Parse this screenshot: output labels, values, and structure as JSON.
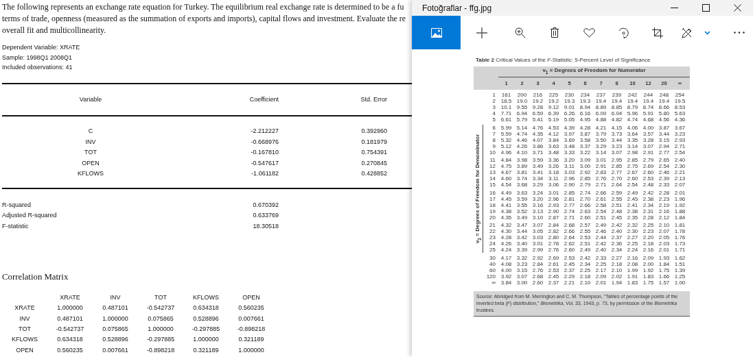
{
  "document": {
    "paragraph_lines": [
      "The following represents an exchange rate equation for Turkey. The equilibrium real exchange rate is determined to be a fu",
      "terms of trade, openness (measured as the summation of exports and imports), capital flows and investment. Evaluate the re",
      "overall fit and multicollinearity."
    ],
    "info": [
      "Dependent Variable: XRATE",
      "Sample: 1998Q1 2008Q1",
      "Included observations: 41"
    ],
    "regression": {
      "columns": [
        "Variable",
        "Coefficient",
        "Std. Error"
      ],
      "rows": [
        {
          "variable": "C",
          "coefficient": "-2.212227",
          "std_error": "0.392960"
        },
        {
          "variable": "INV",
          "coefficient": "-0.668976",
          "std_error": "0.181979"
        },
        {
          "variable": "TOT",
          "coefficient": "-0.167810",
          "std_error": "0.754391"
        },
        {
          "variable": "OPEN",
          "coefficient": "-0.547617",
          "std_error": "0.270845"
        },
        {
          "variable": "KFLOWS",
          "coefficient": "-1.061182",
          "std_error": "0.428852"
        }
      ],
      "stats": [
        {
          "label": "R-squared",
          "value": "0.670392"
        },
        {
          "label": "Adjusted R-squared",
          "value": "0.633769"
        },
        {
          "label": "F-statistic",
          "value": "18.30518"
        }
      ]
    },
    "correlation": {
      "title": "Correlation Matrix",
      "columns": [
        "XRATE",
        "INV",
        "TOT",
        "KFLOWS",
        "OPEN"
      ],
      "rows": [
        {
          "label": "XRATE",
          "values": [
            "1.000000",
            "0.487101",
            "-0.542737",
            "0.634318",
            "0.560235"
          ]
        },
        {
          "label": "INV",
          "values": [
            "0.487101",
            "1.000000",
            "0.075865",
            "0.528896",
            "0.007661"
          ]
        },
        {
          "label": "TOT",
          "values": [
            "-0.542737",
            "0.075865",
            "1.000000",
            "-0.297885",
            "-0.898218"
          ]
        },
        {
          "label": "KFLOWS",
          "values": [
            "0.634318",
            "0.528896",
            "-0.297885",
            "1.000000",
            "0.321189"
          ]
        },
        {
          "label": "OPEN",
          "values": [
            "0.560235",
            "0.007661",
            "-0.898218",
            "0.321189",
            "1.000000"
          ]
        }
      ]
    }
  },
  "photos_window": {
    "title": "Fotoğraflar - ffg.jpg",
    "image": {
      "title": "**Table 2** Critical Values of the *F*-Statistic: 5-Percent Level of Significance",
      "column_axis": "ν$_{1}$ = Degrees of Freedom for Numerator",
      "row_axis": "ν$_{2}$ = Degrees of Freedom for Denominator",
      "columns": [
        "1",
        "2",
        "3",
        "4",
        "5",
        "6",
        "7",
        "8",
        "10",
        "12",
        "20",
        "∞"
      ],
      "groups": [
        {
          "rows": [
            {
              "df": "1",
              "values": [
                "161",
                "200",
                "216",
                "225",
                "230",
                "234",
                "237",
                "239",
                "242",
                "244",
                "248",
                "254"
              ]
            },
            {
              "df": "2",
              "values": [
                "18.5",
                "19.0",
                "19.2",
                "19.2",
                "19.3",
                "19.3",
                "19.4",
                "19.4",
                "19.4",
                "19.4",
                "19.4",
                "19.5"
              ]
            },
            {
              "df": "3",
              "values": [
                "10.1",
                "9.55",
                "9.28",
                "9.12",
                "9.01",
                "8.94",
                "8.89",
                "8.85",
                "8.79",
                "8.74",
                "8.66",
                "8.53"
              ]
            },
            {
              "df": "4",
              "values": [
                "7.71",
                "6.94",
                "6.59",
                "6.39",
                "6.26",
                "6.16",
                "6.09",
                "6.04",
                "5.96",
                "5.91",
                "5.80",
                "5.63"
              ]
            },
            {
              "df": "5",
              "values": [
                "6.61",
                "5.79",
                "5.41",
                "5.19",
                "5.05",
                "4.95",
                "4.88",
                "4.82",
                "4.74",
                "4.68",
                "4.56",
                "4.36"
              ]
            }
          ]
        },
        {
          "rows": [
            {
              "df": "6",
              "values": [
                "5.99",
                "5.14",
                "4.76",
                "4.53",
                "4.39",
                "4.28",
                "4.21",
                "4.15",
                "4.06",
                "4.00",
                "3.87",
                "3.67"
              ]
            },
            {
              "df": "7",
              "values": [
                "5.59",
                "4.74",
                "4.35",
                "4.12",
                "3.97",
                "3.87",
                "3.79",
                "3.73",
                "3.64",
                "3.57",
                "3.44",
                "3.23"
              ]
            },
            {
              "df": "8",
              "values": [
                "5.32",
                "4.46",
                "4.07",
                "3.84",
                "3.69",
                "3.58",
                "3.50",
                "3.44",
                "3.35",
                "3.28",
                "3.15",
                "2.93"
              ]
            },
            {
              "df": "9",
              "values": [
                "5.12",
                "4.26",
                "3.86",
                "3.63",
                "3.48",
                "3.37",
                "3.29",
                "3.23",
                "3.14",
                "3.07",
                "2.94",
                "2.71"
              ]
            },
            {
              "df": "10",
              "values": [
                "4.96",
                "4.10",
                "3.71",
                "3.48",
                "3.33",
                "3.22",
                "3.14",
                "3.07",
                "2.98",
                "2.91",
                "2.77",
                "2.54"
              ]
            }
          ]
        },
        {
          "rows": [
            {
              "df": "11",
              "values": [
                "4.84",
                "3.98",
                "3.59",
                "3.36",
                "3.20",
                "3.09",
                "3.01",
                "2.95",
                "2.85",
                "2.79",
                "2.65",
                "2.40"
              ]
            },
            {
              "df": "12",
              "values": [
                "4.75",
                "3.89",
                "3.49",
                "3.26",
                "3.11",
                "3.00",
                "2.91",
                "2.85",
                "2.75",
                "2.69",
                "2.54",
                "2.30"
              ]
            },
            {
              "df": "13",
              "values": [
                "4.67",
                "3.81",
                "3.41",
                "3.18",
                "3.03",
                "2.92",
                "2.83",
                "2.77",
                "2.67",
                "2.60",
                "2.46",
                "2.21"
              ]
            },
            {
              "df": "14",
              "values": [
                "4.60",
                "3.74",
                "3.34",
                "3.11",
                "2.96",
                "2.85",
                "2.76",
                "2.70",
                "2.60",
                "2.53",
                "2.39",
                "2.13"
              ]
            },
            {
              "df": "15",
              "values": [
                "4.54",
                "3.68",
                "3.29",
                "3.06",
                "2.90",
                "2.79",
                "2.71",
                "2.64",
                "2.54",
                "2.48",
                "2.33",
                "2.07"
              ]
            }
          ]
        },
        {
          "rows": [
            {
              "df": "16",
              "values": [
                "4.49",
                "3.63",
                "3.24",
                "3.01",
                "2.85",
                "2.74",
                "2.66",
                "2.59",
                "2.49",
                "2.42",
                "2.28",
                "2.01"
              ]
            },
            {
              "df": "17",
              "values": [
                "4.45",
                "3.59",
                "3.20",
                "2.96",
                "2.81",
                "2.70",
                "2.61",
                "2.55",
                "2.45",
                "2.38",
                "2.23",
                "1.96"
              ]
            },
            {
              "df": "18",
              "values": [
                "4.41",
                "3.55",
                "3.16",
                "2.93",
                "2.77",
                "2.66",
                "2.58",
                "2.51",
                "2.41",
                "2.34",
                "2.19",
                "1.92"
              ]
            },
            {
              "df": "19",
              "values": [
                "4.38",
                "3.52",
                "3.13",
                "2.90",
                "2.74",
                "2.63",
                "2.54",
                "2.48",
                "2.38",
                "2.31",
                "2.16",
                "1.88"
              ]
            },
            {
              "df": "20",
              "values": [
                "4.35",
                "3.49",
                "3.10",
                "2.87",
                "2.71",
                "2.60",
                "2.51",
                "2.45",
                "2.35",
                "2.28",
                "2.12",
                "1.84"
              ]
            }
          ]
        },
        {
          "rows": [
            {
              "df": "21",
              "values": [
                "4.32",
                "3.47",
                "3.07",
                "2.84",
                "2.68",
                "2.57",
                "2.49",
                "2.42",
                "2.32",
                "2.25",
                "2.10",
                "1.81"
              ]
            },
            {
              "df": "22",
              "values": [
                "4.30",
                "3.44",
                "3.05",
                "2.82",
                "2.66",
                "2.55",
                "2.46",
                "2.40",
                "2.30",
                "2.23",
                "2.07",
                "1.78"
              ]
            },
            {
              "df": "23",
              "values": [
                "4.28",
                "3.42",
                "3.03",
                "2.80",
                "2.64",
                "2.53",
                "2.44",
                "2.37",
                "2.27",
                "2.20",
                "2.05",
                "1.76"
              ]
            },
            {
              "df": "24",
              "values": [
                "4.26",
                "3.40",
                "3.01",
                "2.78",
                "2.62",
                "2.51",
                "2.42",
                "2.36",
                "2.25",
                "2.18",
                "2.03",
                "1.73"
              ]
            },
            {
              "df": "25",
              "values": [
                "4.24",
                "3.39",
                "2.99",
                "2.76",
                "2.60",
                "2.49",
                "2.40",
                "2.34",
                "2.24",
                "2.16",
                "2.01",
                "1.71"
              ]
            }
          ]
        },
        {
          "rows": [
            {
              "df": "30",
              "values": [
                "4.17",
                "3.32",
                "2.92",
                "2.69",
                "2.53",
                "2.42",
                "2.33",
                "2.27",
                "2.16",
                "2.09",
                "1.93",
                "1.62"
              ]
            },
            {
              "df": "40",
              "values": [
                "4.08",
                "3.23",
                "2.84",
                "2.61",
                "2.45",
                "2.34",
                "2.25",
                "2.18",
                "2.08",
                "2.00",
                "1.84",
                "1.51"
              ]
            },
            {
              "df": "60",
              "values": [
                "4.00",
                "3.15",
                "2.76",
                "2.53",
                "2.37",
                "2.25",
                "2.17",
                "2.10",
                "1.99",
                "1.92",
                "1.75",
                "1.39"
              ]
            },
            {
              "df": "120",
              "values": [
                "3.92",
                "3.07",
                "2.68",
                "2.45",
                "2.29",
                "2.18",
                "2.09",
                "2.02",
                "1.91",
                "1.83",
                "1.66",
                "1.25"
              ]
            },
            {
              "df": "∞",
              "values": [
                "3.84",
                "3.00",
                "2.60",
                "2.37",
                "2.21",
                "2.10",
                "2.01",
                "1.94",
                "1.83",
                "1.75",
                "1.57",
                "1.00"
              ]
            }
          ]
        }
      ],
      "source": "Source: Abridged from M. Merrington and C. M. Thompson, “Tables of percentage points of the inverted beta (*F*) distribution,” *Biometrika*, Vol. 33, 1943, p. 73, by permission of the *Biometrika* trustees."
    }
  }
}
